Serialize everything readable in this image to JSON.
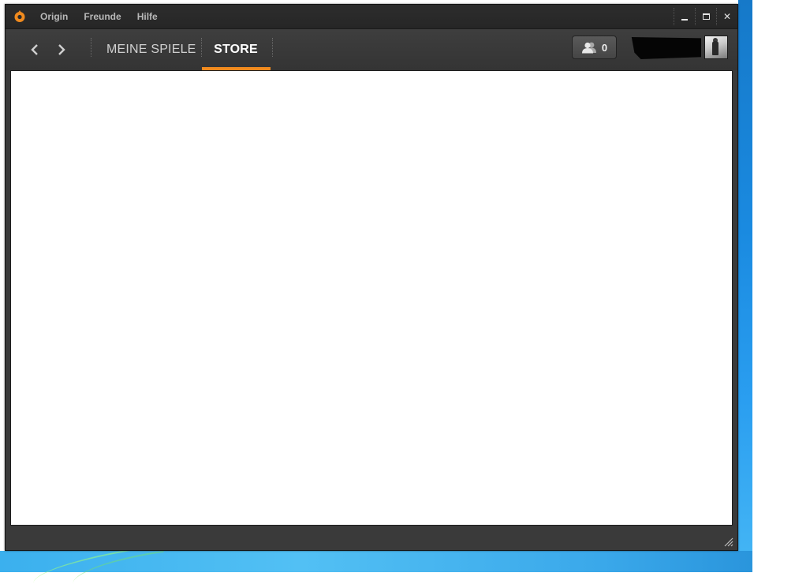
{
  "window": {
    "menu": [
      {
        "label": "Origin"
      },
      {
        "label": "Freunde"
      },
      {
        "label": "Hilfe"
      }
    ],
    "controls": {
      "close_glyph": "✕"
    }
  },
  "nav": {
    "tabs": [
      {
        "label": "MEINE SPIELE"
      },
      {
        "label": "STORE"
      }
    ],
    "active_tab": "STORE",
    "friends_count": "0"
  },
  "colors": {
    "accent": "#f08a1e",
    "chrome": "#3a3a3a",
    "content_bg": "#ffffff"
  },
  "icons": {
    "logo": "origin-logo-icon",
    "back": "chevron-left-icon",
    "forward": "chevron-right-icon",
    "friends": "friends-icon",
    "minimize": "minimize-icon",
    "maximize": "maximize-icon",
    "close": "close-icon",
    "resize": "resize-grip-icon"
  }
}
